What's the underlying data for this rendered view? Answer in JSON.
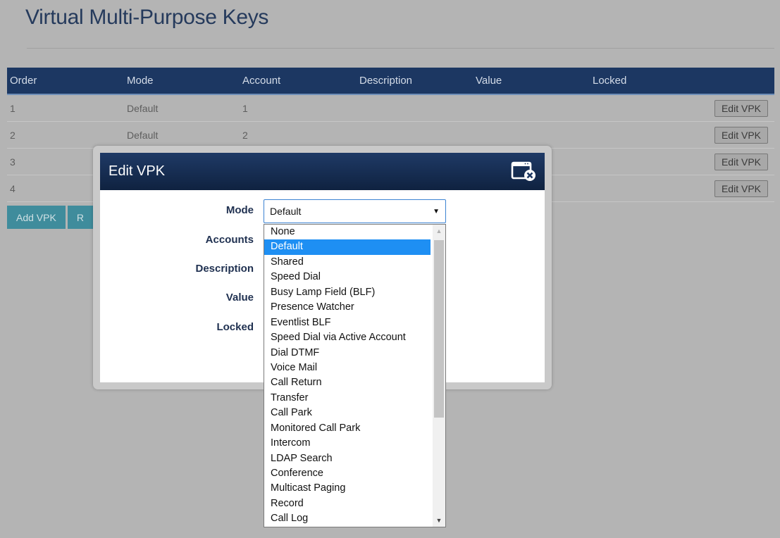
{
  "page": {
    "title": "Virtual Multi-Purpose Keys"
  },
  "table": {
    "headers": [
      "Order",
      "Mode",
      "Account",
      "Description",
      "Value",
      "Locked"
    ],
    "rows": [
      {
        "order": "1",
        "mode": "Default",
        "account": "1",
        "description": "",
        "value": "",
        "locked": "",
        "edit_label": "Edit VPK"
      },
      {
        "order": "2",
        "mode": "Default",
        "account": "2",
        "description": "",
        "value": "",
        "locked": "",
        "edit_label": "Edit VPK"
      },
      {
        "order": "3",
        "mode": "",
        "account": "",
        "description": "",
        "value": "",
        "locked": "",
        "edit_label": "Edit VPK"
      },
      {
        "order": "4",
        "mode": "",
        "account": "",
        "description": "",
        "value": "",
        "locked": "",
        "edit_label": "Edit VPK"
      }
    ]
  },
  "buttons": {
    "add_label": "Add VPK",
    "second_label": "R"
  },
  "modal": {
    "title": "Edit VPK",
    "close_icon": "close-window-icon",
    "labels": {
      "mode": "Mode",
      "accounts": "Accounts",
      "description": "Description",
      "value": "Value",
      "locked": "Locked"
    },
    "mode_value": "Default",
    "mode_options": [
      "None",
      "Default",
      "Shared",
      "Speed Dial",
      "Busy Lamp Field (BLF)",
      "Presence Watcher",
      "Eventlist BLF",
      "Speed Dial via Active Account",
      "Dial DTMF",
      "Voice Mail",
      "Call Return",
      "Transfer",
      "Call Park",
      "Monitored Call Park",
      "Intercom",
      "LDAP Search",
      "Conference",
      "Multicast Paging",
      "Record",
      "Call Log"
    ],
    "selected_option": "Default"
  },
  "colors": {
    "header_bg": "#1c3762",
    "accent_teal": "#3f8c9c",
    "selected_option": "#1e8ff3",
    "title_text": "#253a5c"
  }
}
